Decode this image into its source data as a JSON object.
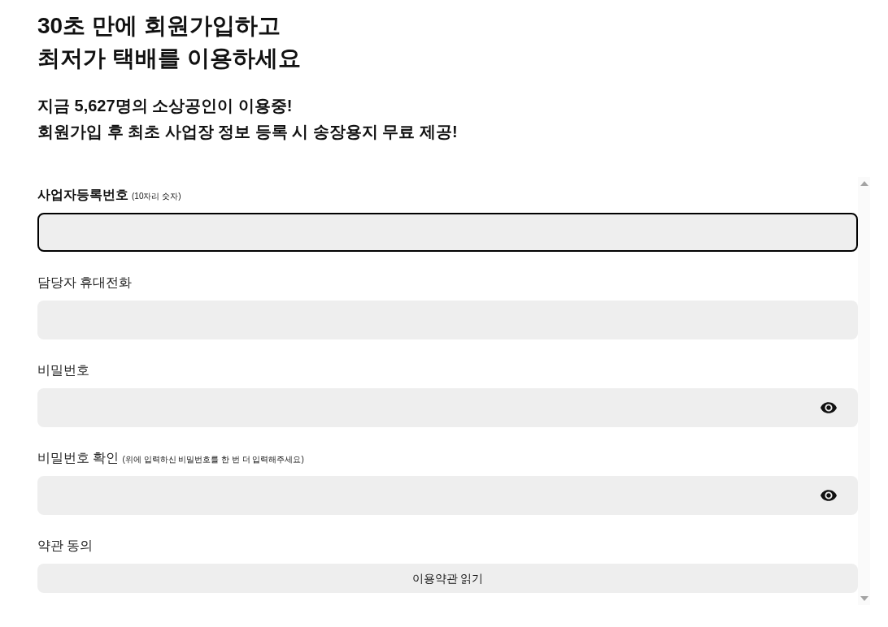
{
  "headline": {
    "lines": [
      "30초 만에 회원가입하고",
      "최저가 택배를 이용하세요"
    ]
  },
  "subheadline": {
    "lines": [
      "지금 5,627명의 소상공인이 이용중!",
      "회원가입 후 최초 사업장 정보 등록 시 송장용지 무료 제공!"
    ]
  },
  "form": {
    "fields": [
      {
        "kind": "text",
        "label": "사업자등록번호",
        "note": "(10자리 숫자)",
        "focused": true
      },
      {
        "kind": "text",
        "label": "담당자 휴대전화",
        "focused": false
      },
      {
        "kind": "password",
        "label": "비밀번호",
        "focused": false
      },
      {
        "kind": "password",
        "label": "비밀번호 확인",
        "note": "(위에 입력하신 비밀번호를 한 번 더 입력해주세요)",
        "focused": false
      },
      {
        "kind": "button",
        "label": "약관 동의",
        "button": "이용약관 읽기"
      }
    ]
  }
}
